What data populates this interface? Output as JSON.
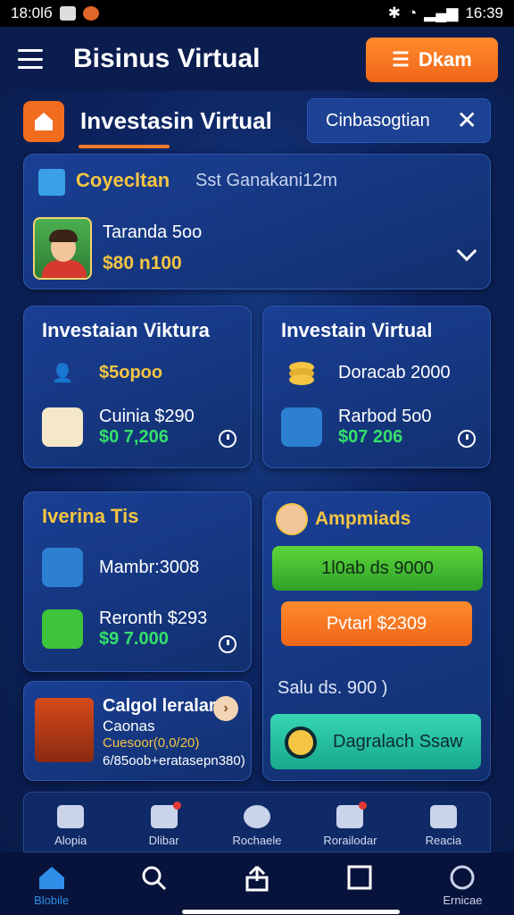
{
  "statusbar": {
    "time_left": "18:0lб",
    "time_right": "16:39"
  },
  "appbar": {
    "title": "Bisinus Virtual",
    "action_label": "Dkam"
  },
  "tabs": {
    "active_label": "Investasin Virtual",
    "second_label": "Cinbasogtian"
  },
  "summary": {
    "title": "Coyecltan",
    "subtitle": "Sst Ganakani12m",
    "name": "Taranda 5oo",
    "amount": "$80 n100"
  },
  "card1": {
    "title": "Investaian Viktura",
    "row1_value": "$5opoo",
    "row2_line1": "Cuinia $290",
    "row2_line2": "$0 7,206"
  },
  "card2": {
    "title": "Investain Virtual",
    "row1_value": "Doracab 2000",
    "row2_line1": "Rarbod 5o0",
    "row2_line2": "$07 206"
  },
  "card3": {
    "title": "Iverina Tis",
    "row1_value": "Mambr:3008",
    "row2_line1": "Reronth $293",
    "row2_line2": "$9 7.000"
  },
  "card4": {
    "title": "Ampmiads",
    "green_button": "1l0ab ds 9000",
    "orange_button": "Pvtarl $2309",
    "salu_text": "Salu   ds. 900 )",
    "teal_button": "Dagralach Ssaw"
  },
  "game": {
    "title": "Calgol leralar",
    "sub": "Caonas",
    "line_yellow": "Cuesoor(0,0/20)",
    "line_white": "6/85oob+eratasepn380)"
  },
  "nav": [
    "Alopia",
    "Dlibar",
    "Rochaele",
    "Rorailodar",
    "Reacia"
  ],
  "bottom": {
    "home_label": "Blobile",
    "last_label": "Ernicae"
  }
}
